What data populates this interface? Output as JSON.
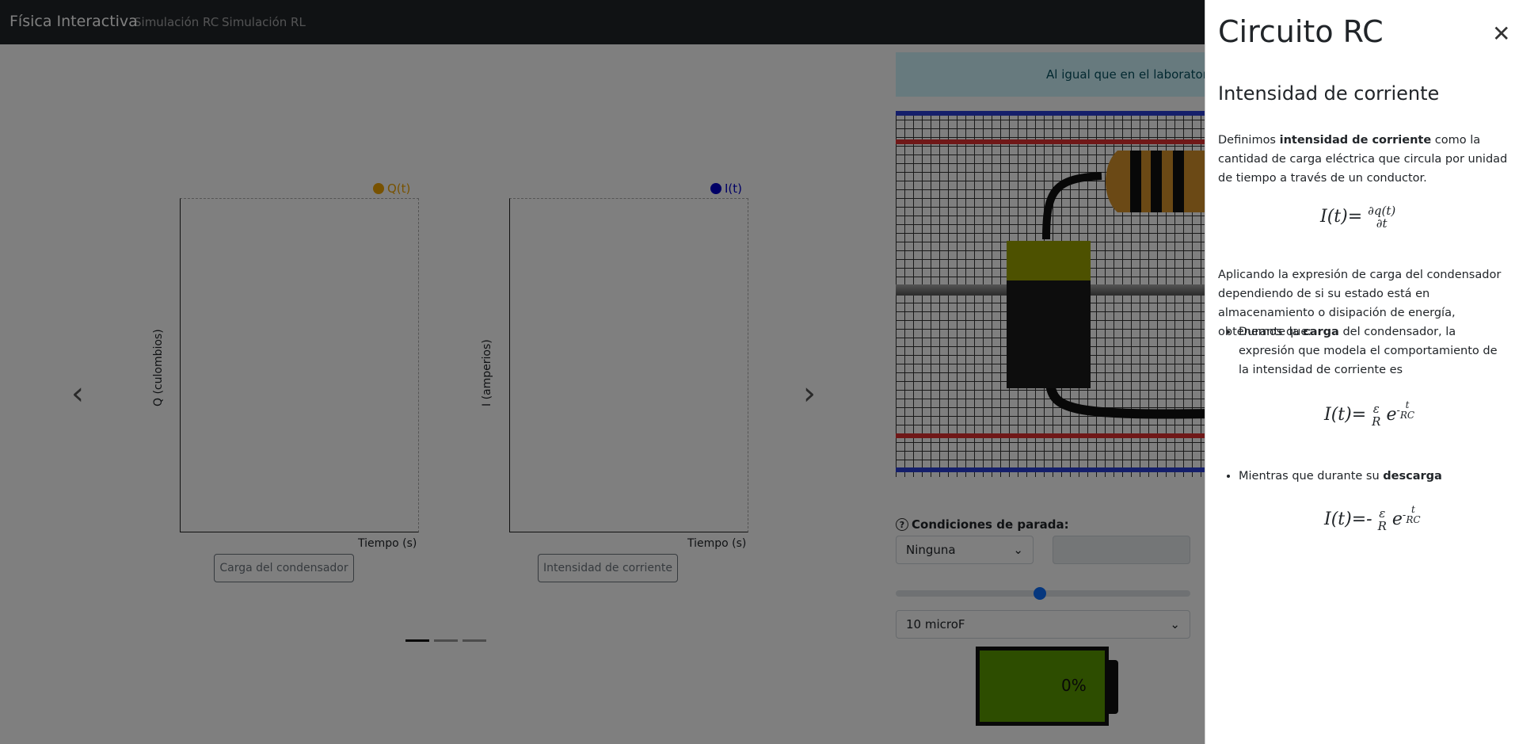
{
  "navbar": {
    "brand": "Física Interactiva",
    "links": [
      "Simulación RC",
      "Simulación RL"
    ]
  },
  "carousel": {
    "charts": [
      {
        "legend": "Q(t)",
        "legend_color": "#f0a500",
        "ylabel": "Q (culombios)",
        "xlabel": "Tiempo (s)",
        "button": "Carga del condensador"
      },
      {
        "legend": "I(t)",
        "legend_color": "#0000cc",
        "ylabel": "I (amperios)",
        "xlabel": "Tiempo (s)",
        "button": "Intensidad de corriente"
      }
    ],
    "prev_icon": "chevron-left-icon",
    "next_icon": "chevron-right-icon"
  },
  "alert": {
    "text": "Al igual que en el laboratorio, e"
  },
  "controls": {
    "stop_label": "Condiciones de parada:",
    "stop_value": "Ninguna",
    "capacitor_value": "10 microF",
    "slider_fraction": 0.49,
    "battery_percent": "0%"
  },
  "offcanvas": {
    "title": "Circuito RC",
    "subtitle": "Intensidad de corriente",
    "p1_before": "Definimos ",
    "p1_bold": "intensidad de corriente",
    "p1_after": " como la cantidad de carga eléctrica que circula por unidad de tiempo a través de un conductor.",
    "p2": "Aplicando la expresión de carga del condensador dependiendo de si su estado está en almacenamiento o disipación de energía, obtenemos que:",
    "li1_before": "Durante la ",
    "li1_bold": "carga",
    "li1_after": " del condensador, la expresión que modela el comportamiento de la intensidad de corriente es",
    "li2_before": "Mientras que durante su ",
    "li2_bold": "descarga",
    "f1_lhs": "I(t)=",
    "f1_num": "∂q(t)",
    "f1_den": "∂t",
    "f2_lhs": "I(t)=",
    "f2_num": "ε",
    "f2_den": "R",
    "f2_base": "e",
    "f2_exp_sign": "-",
    "f2_exp_num": "t",
    "f2_exp_den": "RC",
    "f3_lhs": "I(t)=-",
    "f3_num": "ε",
    "f3_den": "R",
    "f3_base": "e",
    "f3_exp_sign": "-",
    "f3_exp_num": "t",
    "f3_exp_den": "RC"
  },
  "colors": {
    "navbar": "#212529",
    "alert_bg": "#cff4fc",
    "battery_fill": "#5b9b00",
    "slider": "#0d6efd"
  }
}
